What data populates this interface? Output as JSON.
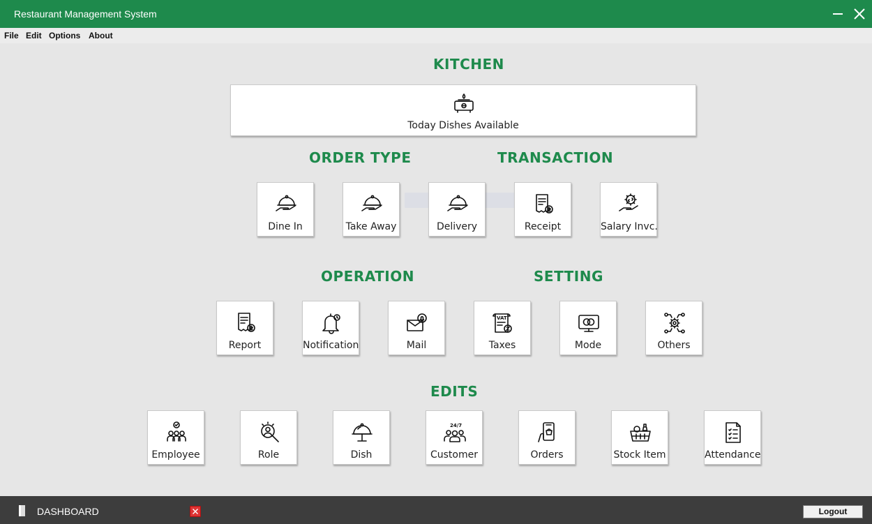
{
  "window": {
    "title": "Restaurant Management System"
  },
  "menu": {
    "file": "File",
    "edit": "Edit",
    "options": "Options",
    "about": "About"
  },
  "sections": {
    "kitchen": "KITCHEN",
    "order_type": "ORDER TYPE",
    "transaction": "TRANSACTION",
    "operation": "OPERATION",
    "setting": "SETTING",
    "edits": "EDITS"
  },
  "kitchen": {
    "today_dishes": "Today Dishes Available"
  },
  "order_type": {
    "dine_in": "Dine In",
    "take_away": "Take Away",
    "delivery": "Delivery"
  },
  "transaction": {
    "receipt": "Receipt",
    "salary": "Salary Invc."
  },
  "operation": {
    "report": "Report",
    "notification": "Notification",
    "mail": "Mail"
  },
  "setting": {
    "taxes": "Taxes",
    "mode": "Mode",
    "others": "Others"
  },
  "edits": {
    "employee": "Employee",
    "role": "Role",
    "dish": "Dish",
    "customer": "Customer",
    "orders": "Orders",
    "stock_item": "Stock Item",
    "attendance": "Attendance"
  },
  "icons": {
    "today_dishes": "stove-icon",
    "dine_in": "cloche-hand-icon",
    "take_away": "cloche-hand-icon",
    "delivery": "cloche-hand-icon",
    "receipt": "receipt-icon",
    "salary": "salary-hand-icon",
    "report": "report-icon",
    "notification": "bell-icon",
    "mail": "mail-icon",
    "taxes": "vat-icon",
    "mode": "monitor-icon",
    "others": "gear-network-icon",
    "employee": "team-icon",
    "role": "role-search-icon",
    "dish": "cloche-icon",
    "customer": "customer-icon",
    "orders": "phone-order-icon",
    "stock_item": "basket-icon",
    "attendance": "checklist-icon"
  },
  "text": {
    "vat": "VAT",
    "support": "24/7"
  },
  "bottom": {
    "dashboard": "DASHBOARD",
    "logout": "Logout"
  },
  "colors": {
    "brand": "#1e8a4c",
    "bottom_bar": "#3d3d3d",
    "close": "#dd3333"
  }
}
